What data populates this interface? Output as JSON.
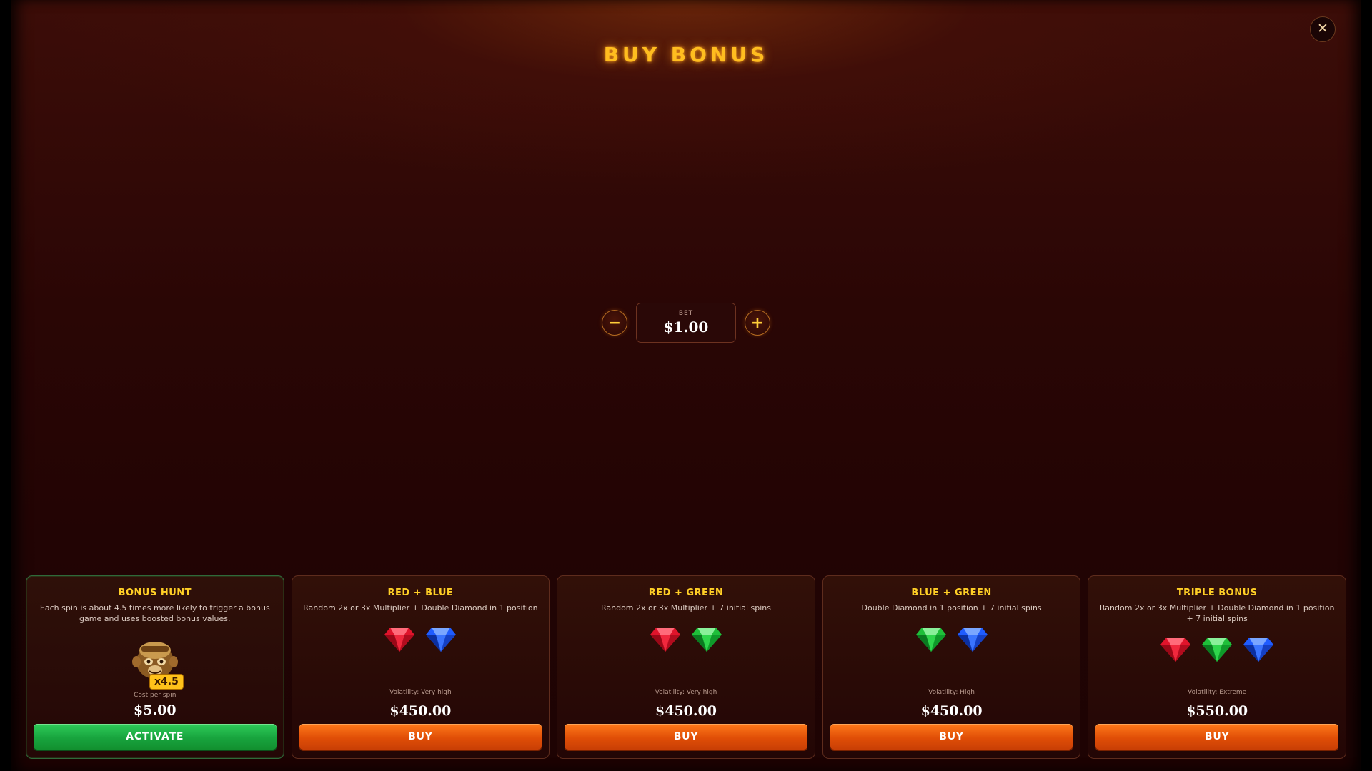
{
  "header": {
    "title": "BUY BONUS",
    "close_label": "✕"
  },
  "bet": {
    "label": "BET",
    "value": "$1.00",
    "minus_label": "−",
    "plus_label": "+"
  },
  "cards": [
    {
      "title": "BONUS HUNT",
      "description": "Each spin is about 4.5 times more likely to trigger a bonus game and uses boosted bonus values.",
      "badge": "x4.5",
      "cost_label": "Cost per spin",
      "price": "$5.00",
      "button_label": "ACTIVATE"
    },
    {
      "title": "RED + BLUE",
      "description": "Random 2x or 3x Multiplier + Double Diamond in 1 position",
      "gems": [
        "red",
        "blue"
      ],
      "volatility": "Volatility: Very high",
      "price": "$450.00",
      "button_label": "BUY"
    },
    {
      "title": "RED + GREEN",
      "description": "Random 2x or 3x Multiplier + 7 initial spins",
      "gems": [
        "red",
        "green"
      ],
      "volatility": "Volatility: Very high",
      "price": "$450.00",
      "button_label": "BUY"
    },
    {
      "title": "BLUE + GREEN",
      "description": "Double Diamond in 1 position + 7 initial spins",
      "gems": [
        "green",
        "blue"
      ],
      "volatility": "Volatility: High",
      "price": "$450.00",
      "button_label": "BUY"
    },
    {
      "title": "TRIPLE BONUS",
      "description": "Random 2x or 3x Multiplier + Double Diamond in 1 position + 7 initial spins",
      "gems": [
        "red",
        "green",
        "blue"
      ],
      "volatility": "Volatility: Extreme",
      "price": "$550.00",
      "button_label": "BUY"
    }
  ],
  "colors": {
    "title_gold": "#ffbd1f",
    "gem_red": "#e0142b",
    "gem_blue": "#1f5cff",
    "gem_green": "#1fbf3a",
    "buy_orange": "#e04e07",
    "activate_green": "#18a43e"
  }
}
